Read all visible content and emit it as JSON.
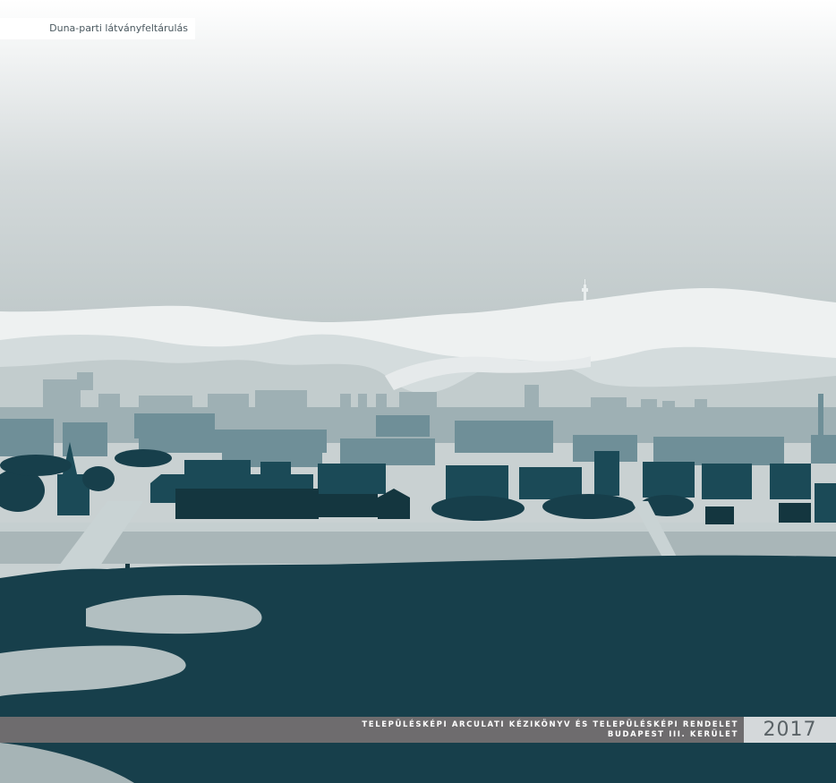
{
  "section_label": "Duna-parti látványfeltárulás",
  "footer": {
    "title_line1": "TELEPÜLÉSKÉPI ARCULATI KÉZIKÖNYV ÉS TELEPÜLÉSKÉPI RENDELET",
    "title_line2": "BUDAPEST  III. KERÜLET",
    "year": "2017"
  },
  "palette": {
    "sky_top": "#ffffff",
    "sky_bottom": "#b9c3c4",
    "hills": "#eef1f1",
    "distant_city": "#9fb1b5",
    "mid_city": "#6f8f98",
    "near_buildings": "#1b4a57",
    "trees": "#173f4b",
    "river": "#a9b6b8",
    "road": "#c9d3d4",
    "footer_bar": "#6e6c6e",
    "year_box": "#d4d8da"
  }
}
